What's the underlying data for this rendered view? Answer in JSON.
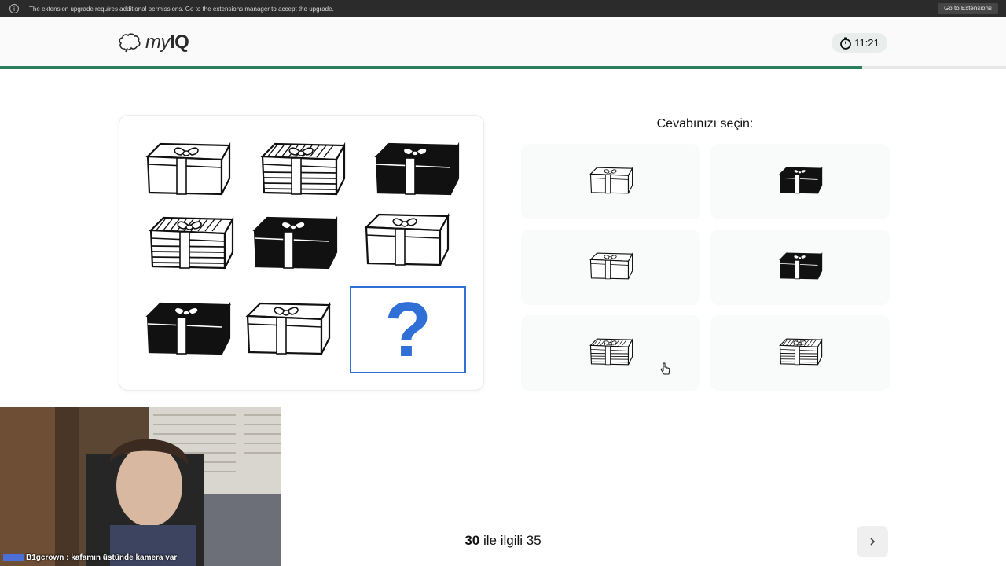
{
  "extension_bar": {
    "message": "The extension upgrade requires additional permissions. Go to the extensions manager to accept the upgrade.",
    "button_label": "Go to Extensions"
  },
  "header": {
    "logo_my": "my",
    "logo_iq": "IQ",
    "timer": "11:21"
  },
  "progress": {
    "value": 0.857
  },
  "puzzle": {
    "grid": [
      [
        "plain-box",
        "striped-box",
        "black-box"
      ],
      [
        "striped-box",
        "black-box",
        "plain-box"
      ],
      [
        "black-box",
        "plain-box",
        "missing"
      ]
    ],
    "missing_label": "?"
  },
  "answers": {
    "prompt": "Cevabınızı seçin:",
    "options": [
      "plain-box",
      "black-box",
      "plain-box",
      "black-box",
      "striped-box",
      "striped-box"
    ]
  },
  "footer": {
    "current": "30",
    "rest": "ile ilgili 35"
  },
  "webcam": {
    "chat_line": "B1gcrown : kafamın üstünde kamera var"
  },
  "colors": {
    "accent_green": "#2e7d5f",
    "question_blue": "#2f6fd6"
  }
}
